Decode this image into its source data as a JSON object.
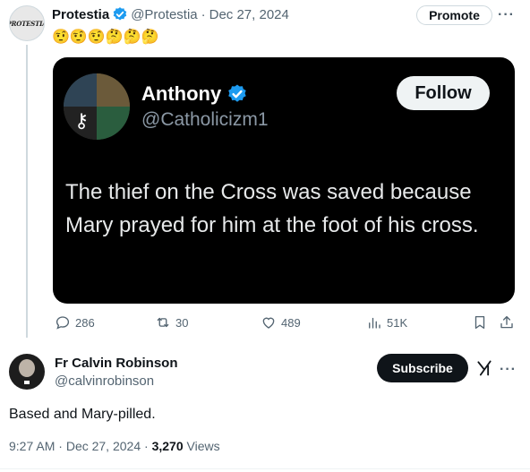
{
  "post": {
    "author_name": "Protestia",
    "avatar_text": "PROTESTIA",
    "handle": "@Protestia",
    "separator": "·",
    "date": "Dec 27, 2024",
    "emojis": "🤨🤨🤨🤔🤔🤔",
    "promote_label": "Promote",
    "more_glyph": "···"
  },
  "quote": {
    "author_name": "Anthony",
    "handle": "@Catholicizm1",
    "follow_label": "Follow",
    "text": "The thief on the Cross was saved because Mary prayed for him at the foot of his cross."
  },
  "actions": {
    "replies": "286",
    "reposts": "30",
    "likes": "489",
    "views": "51K"
  },
  "reply": {
    "author_name": "Fr Calvin Robinson",
    "handle": "@calvinrobinson",
    "subscribe_label": "Subscribe",
    "more_glyph": "···",
    "text": "Based and Mary-pilled.",
    "time": "9:27 AM",
    "separator": "·",
    "date": "Dec 27, 2024",
    "separator2": "·",
    "views_count": "3,270",
    "views_label": "Views"
  },
  "colors": {
    "verified_blue": "#1d9bf0",
    "text_secondary": "#536471",
    "quote_background": "#000000"
  },
  "icons": [
    "verified-badge-icon",
    "reply-icon",
    "repost-icon",
    "like-icon",
    "views-icon",
    "bookmark-icon",
    "share-icon",
    "grok-icon"
  ]
}
